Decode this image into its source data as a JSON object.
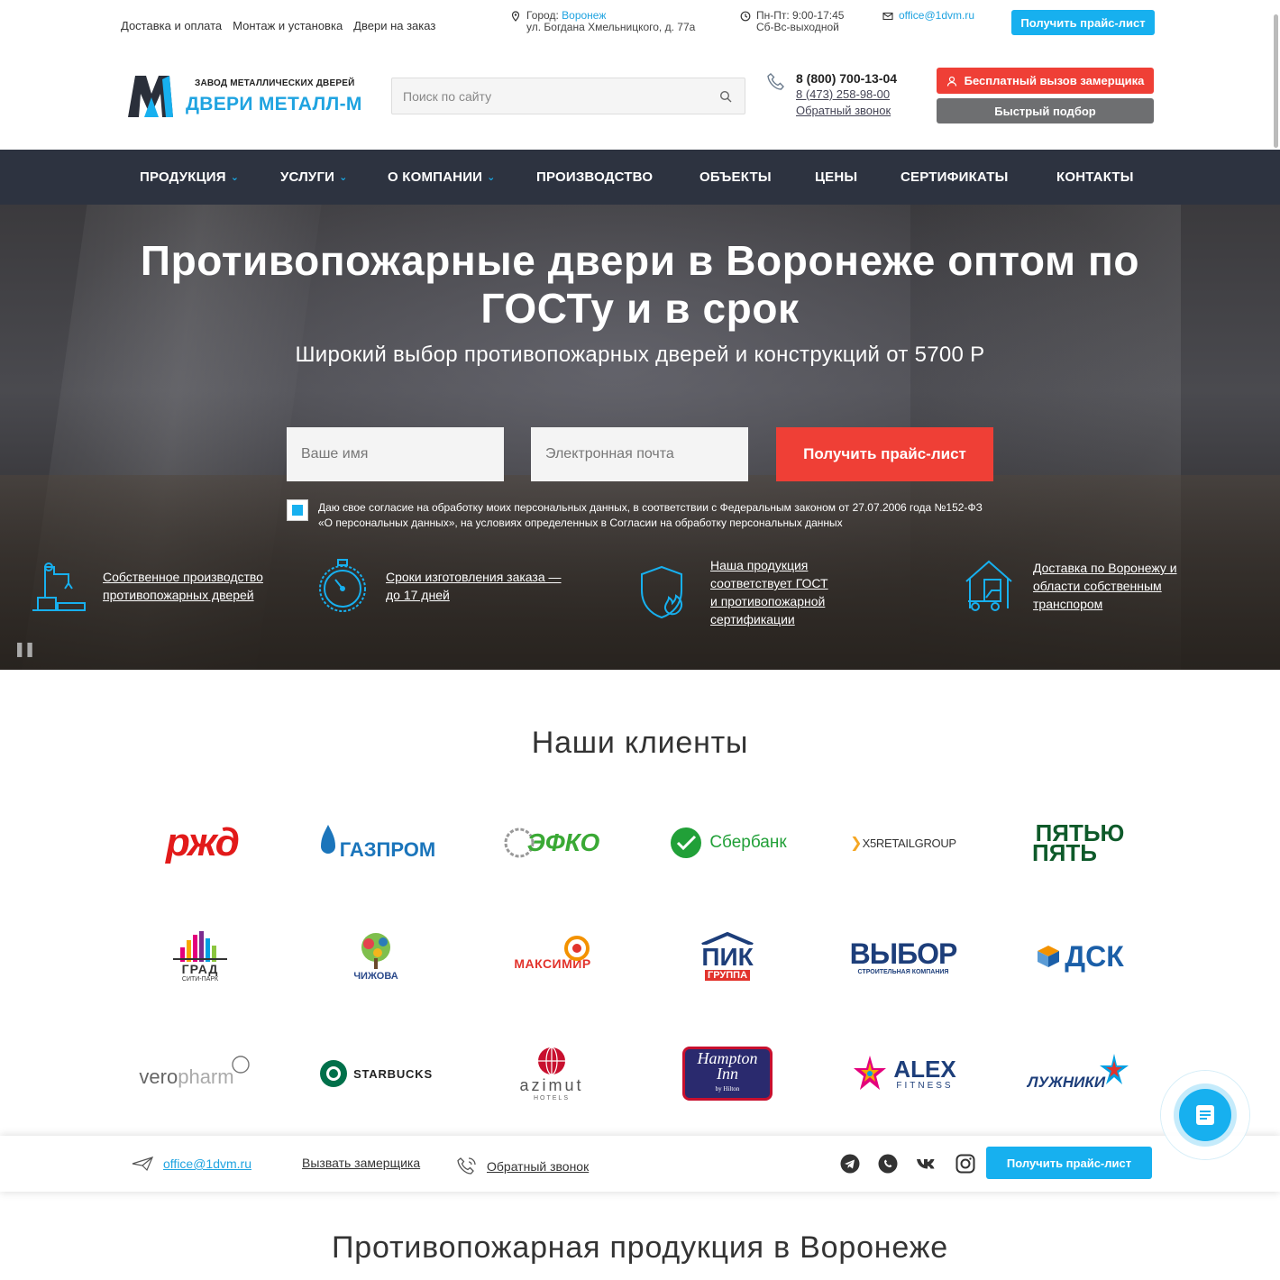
{
  "topbar": {
    "links": [
      "Доставка и оплата",
      "Монтаж и установка",
      "Двери на заказ"
    ],
    "city_label": "Город:",
    "city_name": "Воронеж",
    "address": "ул. Богдана Хмельницкого, д. 77а",
    "hours_line1": "Пн-Пт: 9:00-17:45",
    "hours_line2": "Сб-Вс-выходной",
    "email": "office@1dvm.ru",
    "price_button": "Получить прайс-лист"
  },
  "header": {
    "logo_sub": "ЗАВОД МЕТАЛЛИЧЕСКИХ ДВЕРЕЙ",
    "logo_name": "ДВЕРИ МЕТАЛЛ-М",
    "search_placeholder": "Поиск по сайту",
    "phone_main": "8 (800) 700-13-04",
    "phone_local": "8 (473) 258-98-00",
    "callback_link": "Обратный звонок",
    "measure_button": "Бесплатный вызов замерщика",
    "quick_pick_button": "Быстрый подбор"
  },
  "nav": {
    "items": [
      {
        "label": "ПРОДУКЦИЯ",
        "dropdown": true
      },
      {
        "label": "УСЛУГИ",
        "dropdown": true
      },
      {
        "label": "О КОМПАНИИ",
        "dropdown": true
      },
      {
        "label": "ПРОИЗВОДСТВО",
        "dropdown": false
      },
      {
        "label": "ОБЪЕКТЫ",
        "dropdown": false
      },
      {
        "label": "ЦЕНЫ",
        "dropdown": false
      },
      {
        "label": "СЕРТИФИКАТЫ",
        "dropdown": false
      },
      {
        "label": "КОНТАКТЫ",
        "dropdown": false
      }
    ]
  },
  "hero": {
    "title_line1": "Противопожарные двери в Воронеже оптом по",
    "title_line2": "ГОСТу и в срок",
    "subtitle": "Широкий выбор противопожарных дверей и конструкций от 5700 Р",
    "name_placeholder": "Ваше имя",
    "email_placeholder": "Электронная почта",
    "submit_button": "Получить прайс-лист",
    "consent_checked": true,
    "consent_text": "Даю свое согласие на обработку моих персональных данных, в соответствии с Федеральным законом от 27.07.2006 года №152-ФЗ «О персональных данных», на условиях определенных в Согласии на обработку персональных данных",
    "features": [
      {
        "icon": "factory-robot-icon",
        "text1": "Собственное производство",
        "text2": "противопожарных дверей"
      },
      {
        "icon": "stopwatch-icon",
        "text1": "Сроки изготовления заказа —",
        "text2": "до 17 дней"
      },
      {
        "icon": "fire-shield-icon",
        "text1": "Наша продукция",
        "text2": "соответствует ГОСТ",
        "text3": "и противопожарной",
        "text4": "сертификации"
      },
      {
        "icon": "delivery-truck-icon",
        "text1": "Доставка по Воронежу и",
        "text2": "области собственным",
        "text3": "транспором"
      }
    ]
  },
  "clients": {
    "title": "Наши клиенты",
    "logos": [
      "ржд",
      "ГАЗПРОМ",
      "ЭФКО",
      "Сбербанк",
      "X5RETAILGROUP",
      "ПЯТЬЮ",
      "ПЯТЬ",
      "ГРАД",
      "СИТИ-ПАРК",
      "ЧИЖОВА",
      "МАКСИМИР",
      "ПИК",
      "ГРУППА",
      "ВЫБОР",
      "СТРОИТЕЛЬНАЯ КОМПАНИЯ",
      "ДСК",
      "vero",
      "pharm",
      "STARBUCKS",
      "azimut",
      "HOTELS",
      "Hampton",
      "Inn",
      "by Hilton",
      "ALEX",
      "FITNESS",
      "ЛУЖНИКИ"
    ]
  },
  "bottom_bar": {
    "email": "office@1dvm.ru",
    "measure_link": "Вызвать замерщика",
    "callback_link": "Обратный звонок",
    "price_button": "Получить прайс-лист",
    "social": [
      "telegram-icon",
      "whatsapp-icon",
      "vk-icon",
      "instagram-icon"
    ]
  },
  "products": {
    "title": "Противопожарная продукция в Воронеже"
  },
  "colors": {
    "accent_blue": "#17b0ef",
    "accent_red": "#ef3f36",
    "nav_bg": "#2d3340",
    "grey_button": "#6e6f71"
  }
}
